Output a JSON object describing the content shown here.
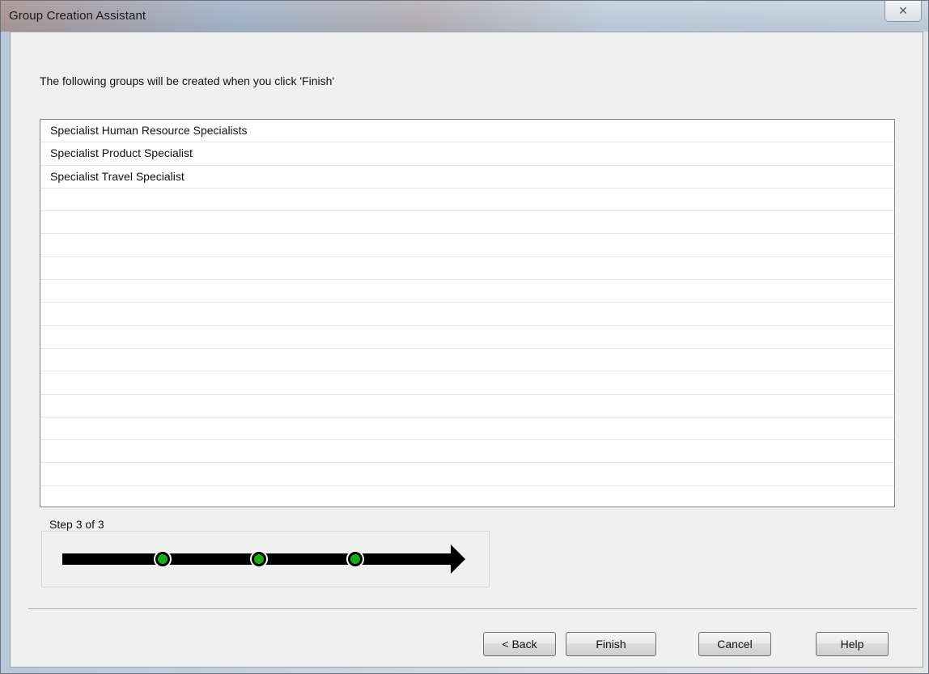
{
  "window": {
    "title": "Group Creation Assistant",
    "close_glyph": "✕"
  },
  "instruction": "The following groups will be created when you click 'Finish'",
  "groups": [
    "Specialist Human Resource Specialists",
    "Specialist Product Specialist",
    "Specialist Travel Specialist"
  ],
  "progress": {
    "label": "Step 3 of 3",
    "current_step": 3,
    "total_steps": 3,
    "step_color": "#1aaa1a"
  },
  "buttons": {
    "back": "< Back",
    "finish": "Finish",
    "cancel": "Cancel",
    "help": "Help"
  }
}
